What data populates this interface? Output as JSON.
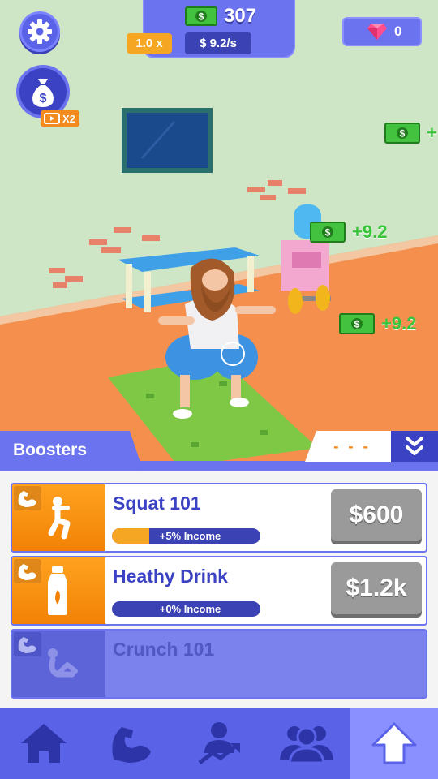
{
  "hud": {
    "money": "307",
    "multiplier": "1.0 x",
    "rate": "$ 9.2/s",
    "gems": "0",
    "bag_badge": "X2"
  },
  "floating_cash": [
    "+",
    "+9.2",
    "+9.2"
  ],
  "boosters": {
    "title": "Boosters",
    "tab_indicator": "- - -",
    "items": [
      {
        "name": "Squat 101",
        "income": "+5% Income",
        "progress": 0.25,
        "price": "$600",
        "locked": false
      },
      {
        "name": "Heathy Drink",
        "income": "+0% Income",
        "progress": 0.0,
        "price": "$1.2k",
        "locked": false
      },
      {
        "name": "Crunch 101",
        "locked": true
      }
    ]
  },
  "nav": {
    "items": [
      "home-icon",
      "muscle-icon",
      "trainer-icon",
      "group-icon",
      "upgrade-arrow-icon"
    ],
    "active": 4
  },
  "colors": {
    "primary": "#5a62e8",
    "accent": "#f5a623",
    "cash_green": "#39c43c"
  }
}
